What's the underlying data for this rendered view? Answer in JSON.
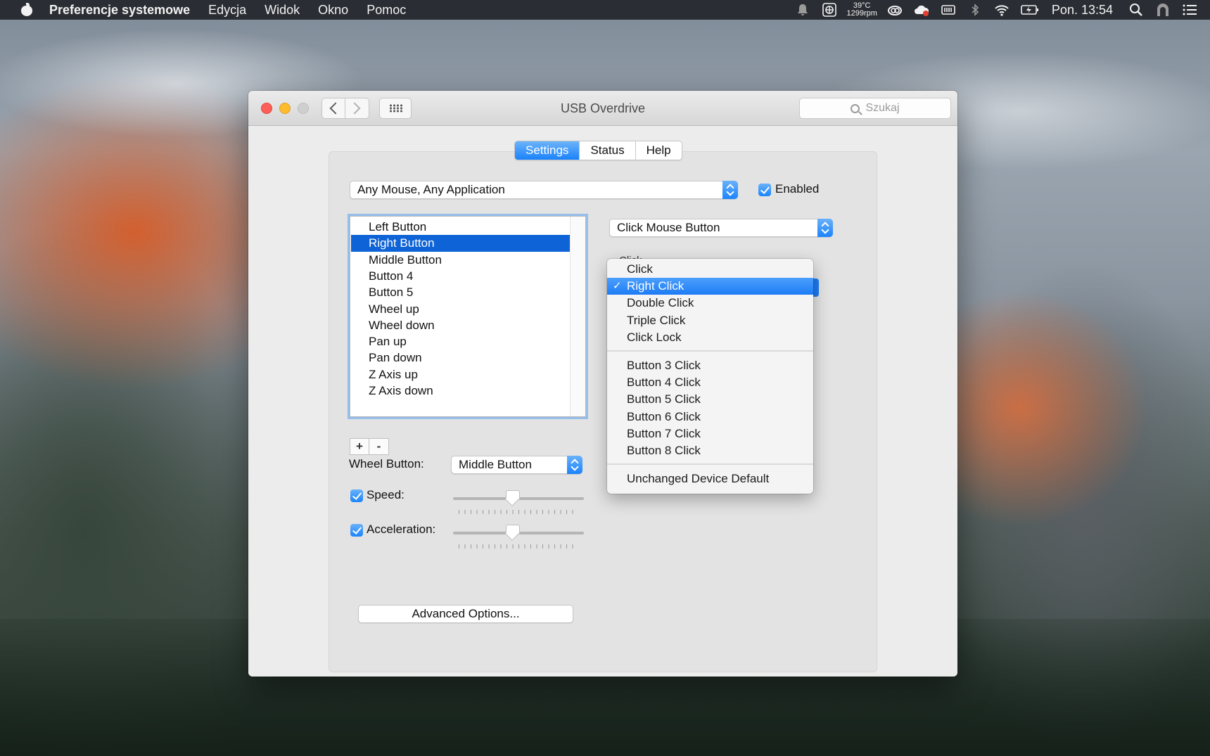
{
  "menubar": {
    "app_name": "Preferencje systemowe",
    "items": [
      "Edycja",
      "Widok",
      "Okno",
      "Pomoc"
    ],
    "temp": "39°C",
    "fan": "1299rpm",
    "clock": "Pon. 13:54",
    "icons": [
      "notification-icon",
      "fan-icon",
      "creative-cloud-icon",
      "cloud-icon",
      "memory-icon",
      "bluetooth-icon",
      "wifi-icon",
      "battery-icon",
      "spotlight-icon",
      "user-icon",
      "list-icon"
    ]
  },
  "window": {
    "title": "USB Overdrive",
    "search_placeholder": "Szukaj"
  },
  "tabs": [
    {
      "label": "Settings",
      "active": true
    },
    {
      "label": "Status",
      "active": false
    },
    {
      "label": "Help",
      "active": false
    }
  ],
  "device_popup": "Any Mouse, Any Application",
  "enabled": {
    "label": "Enabled",
    "checked": true
  },
  "buttons_list": {
    "items": [
      "Left Button",
      "Right Button",
      "Middle Button",
      "Button 4",
      "Button 5",
      "Wheel up",
      "Wheel down",
      "Pan up",
      "Pan down",
      "Z Axis up",
      "Z Axis down"
    ],
    "selected_index": 1,
    "add_label": "+",
    "remove_label": "-"
  },
  "action_popup": "Click Mouse Button",
  "click_menu": {
    "peek_label": "Click",
    "groups": [
      [
        "Click",
        "Right Click",
        "Double Click",
        "Triple Click",
        "Click Lock"
      ],
      [
        "Button 3 Click",
        "Button 4 Click",
        "Button 5 Click",
        "Button 6 Click",
        "Button 7 Click",
        "Button 8 Click"
      ],
      [
        "Unchanged Device Default"
      ]
    ],
    "selected": "Right Click",
    "checkmark": "✓"
  },
  "wheel_button": {
    "label": "Wheel Button:",
    "value": "Middle Button"
  },
  "speed": {
    "label": "Speed:",
    "checked": true,
    "value_fraction": 0.45
  },
  "acceleration": {
    "label": "Acceleration:",
    "checked": true,
    "value_fraction": 0.45
  },
  "advanced_button": "Advanced Options..."
}
